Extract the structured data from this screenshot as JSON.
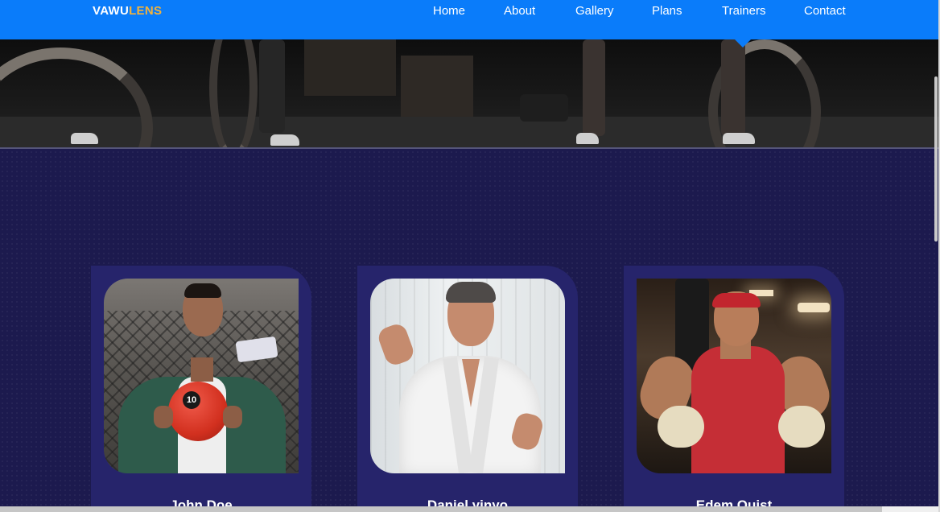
{
  "brand": {
    "part1": "VAWU",
    "part2": "LENS"
  },
  "nav": {
    "items": [
      {
        "label": "Home"
      },
      {
        "label": "About"
      },
      {
        "label": "Gallery"
      },
      {
        "label": "Plans"
      },
      {
        "label": "Trainers"
      },
      {
        "label": "Contact"
      }
    ],
    "active": "Trainers"
  },
  "trainers": [
    {
      "name": "John Doe"
    },
    {
      "name": "Daniel yinyo"
    },
    {
      "name": "Edem Quist"
    }
  ],
  "colors": {
    "nav_bg": "#0a7cfa",
    "logo_accent": "#f2b33d",
    "section_bg": "#1c1a4e",
    "card_bg": "#26246b"
  }
}
